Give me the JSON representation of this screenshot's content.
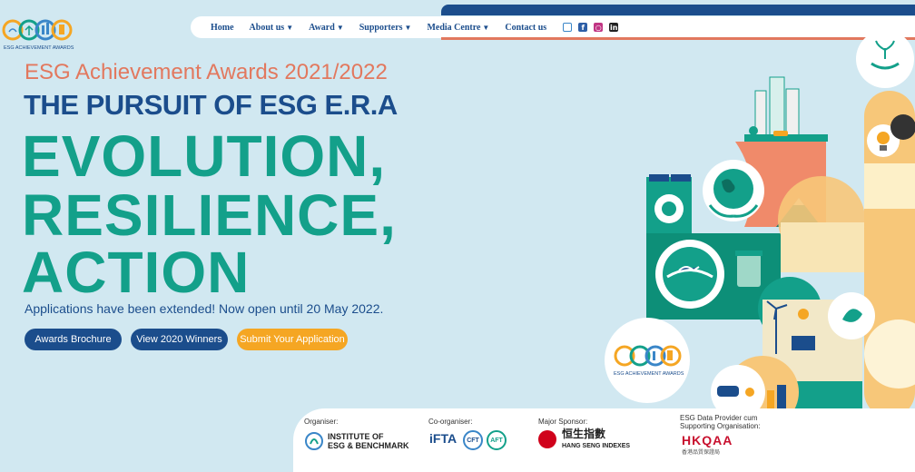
{
  "logo": {
    "caption": "ESG ACHIEVEMENT AWARDS"
  },
  "nav": {
    "items": [
      {
        "label": "Home",
        "dropdown": false
      },
      {
        "label": "About us",
        "dropdown": true
      },
      {
        "label": "Award",
        "dropdown": true
      },
      {
        "label": "Supporters",
        "dropdown": true
      },
      {
        "label": "Media Centre",
        "dropdown": true
      },
      {
        "label": "Contact us",
        "dropdown": false
      }
    ],
    "social_icons": [
      "mail-icon",
      "facebook-icon",
      "instagram-icon",
      "linkedin-icon"
    ]
  },
  "hero": {
    "subtitle": "ESG Achievement Awards 2021/2022",
    "headline": "THE PURSUIT OF ESG E.R.A",
    "line1": "EVOLUTION,",
    "line2": "RESILIENCE,",
    "line3": "ACTION",
    "notice": "Applications have been extended! Now open until 20 May 2022."
  },
  "buttons": {
    "brochure": "Awards Brochure",
    "winners": "View 2020 Winners",
    "apply": "Submit Your Application"
  },
  "sponsors": {
    "organiser_label": "Organiser:",
    "organiser_line1": "INSTITUTE OF",
    "organiser_line2": "ESG & BENCHMARK",
    "coorganiser_label": "Co-organiser:",
    "iFTA": "iFTA",
    "cft": "CFT",
    "aft": "AFT",
    "major_label": "Major Sponsor:",
    "major_chinese": "恒生指數",
    "major_english": "HANG SENG INDEXES",
    "provider_label_1": "ESG Data Provider cum",
    "provider_label_2": "Supporting Organisation:",
    "provider_name": "HKQAA",
    "provider_chinese": "香港品質保證局"
  },
  "colors": {
    "background": "#d1e8f1",
    "navy": "#1b4d8c",
    "teal": "#13a08a",
    "coral": "#e2785e",
    "orange": "#f5a623"
  }
}
